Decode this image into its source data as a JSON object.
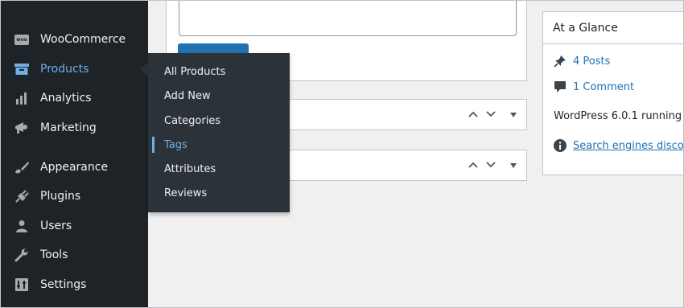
{
  "sidebar": {
    "items": [
      {
        "label": "WooCommerce",
        "icon": "woocommerce-icon"
      },
      {
        "label": "Products",
        "icon": "products-icon",
        "active": true
      },
      {
        "label": "Analytics",
        "icon": "analytics-icon"
      },
      {
        "label": "Marketing",
        "icon": "megaphone-icon"
      },
      {
        "label": "Appearance",
        "icon": "paintbrush-icon"
      },
      {
        "label": "Plugins",
        "icon": "plug-icon"
      },
      {
        "label": "Users",
        "icon": "user-icon"
      },
      {
        "label": "Tools",
        "icon": "wrench-icon"
      },
      {
        "label": "Settings",
        "icon": "settings-icon"
      }
    ],
    "woo_badge": "woo"
  },
  "flyout": {
    "items": [
      {
        "label": "All Products"
      },
      {
        "label": "Add New"
      },
      {
        "label": "Categories"
      },
      {
        "label": "Tags",
        "current": true
      },
      {
        "label": "Attributes"
      },
      {
        "label": "Reviews"
      }
    ]
  },
  "glance": {
    "title": "At a Glance",
    "posts": "4 Posts",
    "comments": "1 Comment",
    "version": "WordPress 6.0.1 running",
    "search_notice": "Search engines disco"
  },
  "widget_controls": {
    "up": "^",
    "down": "v",
    "toggle": "▾"
  },
  "colors": {
    "sidebar_bg": "#1d2327",
    "flyout_bg": "#2c3338",
    "accent": "#72aee6",
    "link": "#2271b1"
  }
}
